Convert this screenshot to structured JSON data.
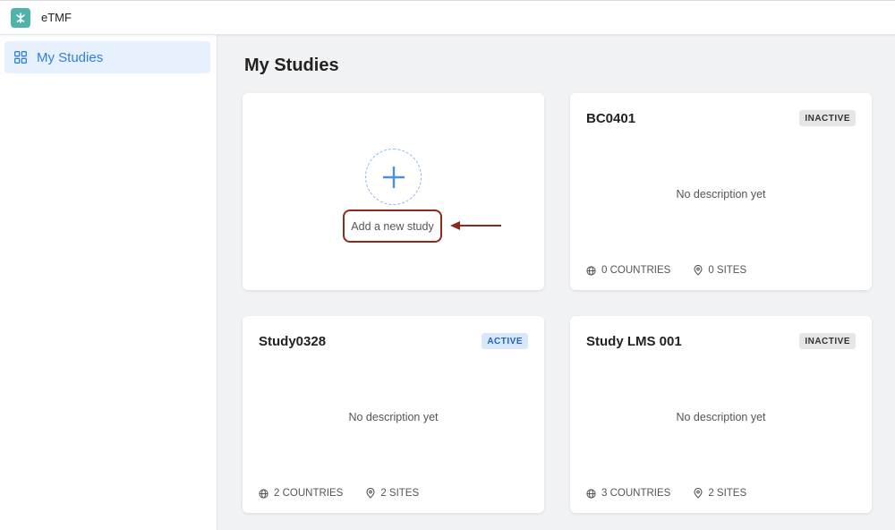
{
  "app": {
    "title": "eTMF"
  },
  "sidebar": {
    "items": [
      {
        "label": "My Studies",
        "icon": "grid-icon"
      }
    ]
  },
  "main": {
    "title": "My Studies",
    "add_card": {
      "label": "Add a new study",
      "icon": "plus-icon"
    },
    "studies": [
      {
        "name": "BC0401",
        "status": "INACTIVE",
        "description": "No description yet",
        "countries": "0 COUNTRIES",
        "sites": "0 SITES"
      },
      {
        "name": "Study0328",
        "status": "ACTIVE",
        "description": "No description yet",
        "countries": "2 COUNTRIES",
        "sites": "2 SITES"
      },
      {
        "name": "Study LMS 001",
        "status": "INACTIVE",
        "description": "No description yet",
        "countries": "3 COUNTRIES",
        "sites": "2 SITES"
      }
    ]
  },
  "colors": {
    "accent": "#2f7fe0",
    "logo": "#4fb3a9",
    "annotation": "#8e2a1c"
  }
}
